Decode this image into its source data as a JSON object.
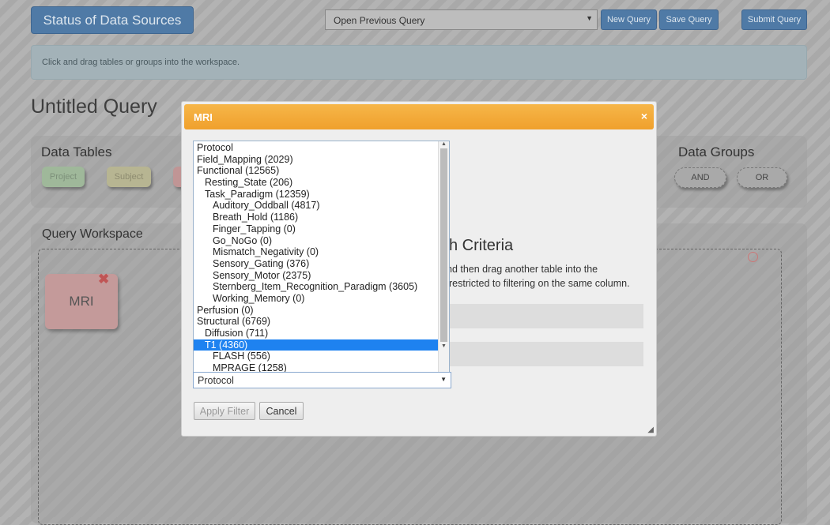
{
  "header": {
    "status_button": "Status of Data Sources",
    "open_query_placeholder": "Open Previous Query",
    "new_query": "New Query",
    "save_query": "Save Query",
    "submit_query": "Submit Query"
  },
  "info": "Click and drag tables or groups into the workspace.",
  "query_title": "Untitled Query",
  "data_tables": {
    "title": "Data Tables",
    "chips": [
      "Project",
      "Subject"
    ]
  },
  "data_groups": {
    "title": "Data Groups",
    "chips": [
      "AND",
      "OR"
    ]
  },
  "workspace": {
    "title": "Query Workspace",
    "table_box": "MRI"
  },
  "modal": {
    "title": "MRI",
    "close": "×",
    "heading_fragment": "h Criteria",
    "text_line1": "nd then drag another table into the",
    "text_line2": "restricted to filtering on the same column.",
    "list_items": [
      {
        "label": "Protocol",
        "level": 0
      },
      {
        "label": "Field_Mapping (2029)",
        "level": 0
      },
      {
        "label": "Functional (12565)",
        "level": 0
      },
      {
        "label": "Resting_State (206)",
        "level": 1
      },
      {
        "label": "Task_Paradigm (12359)",
        "level": 1
      },
      {
        "label": "Auditory_Oddball (4817)",
        "level": 2
      },
      {
        "label": "Breath_Hold (1186)",
        "level": 2
      },
      {
        "label": "Finger_Tapping (0)",
        "level": 2
      },
      {
        "label": "Go_NoGo (0)",
        "level": 2
      },
      {
        "label": "Mismatch_Negativity (0)",
        "level": 2
      },
      {
        "label": "Sensory_Gating (376)",
        "level": 2
      },
      {
        "label": "Sensory_Motor (2375)",
        "level": 2
      },
      {
        "label": "Sternberg_Item_Recognition_Paradigm (3605)",
        "level": 2
      },
      {
        "label": "Working_Memory (0)",
        "level": 2
      },
      {
        "label": "Perfusion (0)",
        "level": 0
      },
      {
        "label": "Structural (6769)",
        "level": 0
      },
      {
        "label": "Diffusion (711)",
        "level": 1
      },
      {
        "label": "T1 (4360)",
        "level": 1,
        "selected": true
      },
      {
        "label": "FLASH (556)",
        "level": 2
      },
      {
        "label": "MPRAGE (1258)",
        "level": 2
      }
    ],
    "select_value": "Protocol",
    "apply_filter": "Apply Filter",
    "cancel": "Cancel"
  },
  "colors": {
    "header_orange": "#f2a635",
    "selected_blue": "#1e82f0",
    "primary_button": "#4f7aa6"
  }
}
